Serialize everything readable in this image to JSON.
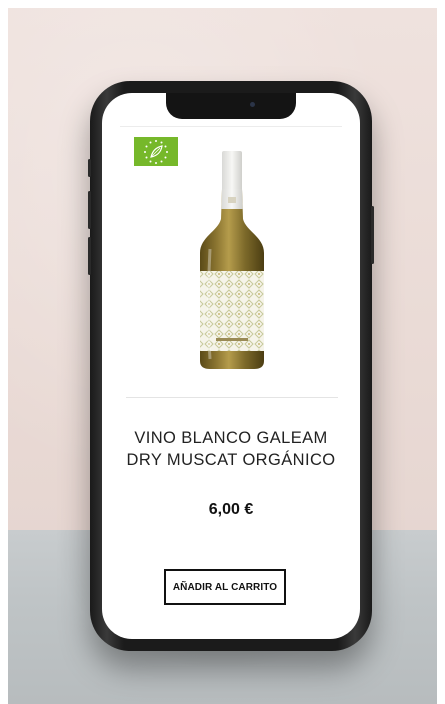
{
  "product": {
    "title": "VINO BLANCO GALEAM\nDRY MUSCAT ORGÁNICO",
    "price": "6,00 €",
    "add_to_cart_label": "AÑADIR AL CARRITO",
    "badge_icon": "eu-organic-leaf-icon",
    "image_icon": "wine-bottle-icon"
  },
  "colors": {
    "badge_green": "#76b82a",
    "text": "#222222",
    "button_border": "#111111",
    "wall": "#ebdcd7",
    "floor": "#c2c6c8"
  }
}
